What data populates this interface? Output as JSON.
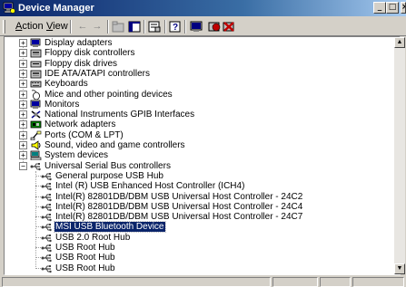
{
  "window": {
    "title": "Device Manager",
    "minimize": "_",
    "maximize": "□",
    "close": "×"
  },
  "menu": [
    {
      "label": "Action",
      "accel": "A",
      "rest": "ction"
    },
    {
      "label": "View",
      "accel": "V",
      "rest": "iew"
    }
  ],
  "toolbar": {
    "back": "←",
    "forward": "→"
  },
  "tree": {
    "collapsed_symbol": "+",
    "expanded_symbol": "−",
    "categories": [
      {
        "label": "Display adapters",
        "icon": "monitor-icon"
      },
      {
        "label": "Floppy disk controllers",
        "icon": "controller-icon"
      },
      {
        "label": "Floppy disk drives",
        "icon": "floppy-drive-icon"
      },
      {
        "label": "IDE ATA/ATAPI controllers",
        "icon": "controller-icon"
      },
      {
        "label": "Keyboards",
        "icon": "keyboard-icon"
      },
      {
        "label": "Mice and other pointing devices",
        "icon": "mouse-icon"
      },
      {
        "label": "Monitors",
        "icon": "monitor-icon"
      },
      {
        "label": "National Instruments GPIB Interfaces",
        "icon": "gpib-icon"
      },
      {
        "label": "Network adapters",
        "icon": "network-icon"
      },
      {
        "label": "Ports (COM & LPT)",
        "icon": "port-icon"
      },
      {
        "label": "Sound, video and game controllers",
        "icon": "sound-icon"
      },
      {
        "label": "System devices",
        "icon": "computer-icon"
      },
      {
        "label": "Universal Serial Bus controllers",
        "icon": "usb-icon",
        "expanded": true
      }
    ],
    "usb_children": [
      "General purpose USB Hub",
      "Intel (R) USB Enhanced Host Controller (ICH4)",
      "Intel(R) 82801DB/DBM USB Universal Host Controller - 24C2",
      "Intel(R) 82801DB/DBM USB Universal Host Controller - 24C4",
      "Intel(R) 82801DB/DBM USB Universal Host Controller - 24C7",
      "MSI USB Bluetooth Device",
      "USB 2.0 Root Hub",
      "USB Root Hub",
      "USB Root Hub",
      "USB Root Hub"
    ],
    "selected_child": "MSI USB Bluetooth Device"
  },
  "scrollbar": {
    "up": "▲",
    "down": "▼"
  },
  "colors": {
    "selection": "#0a246a",
    "title_start": "#0a246a",
    "title_end": "#a6caf0"
  }
}
